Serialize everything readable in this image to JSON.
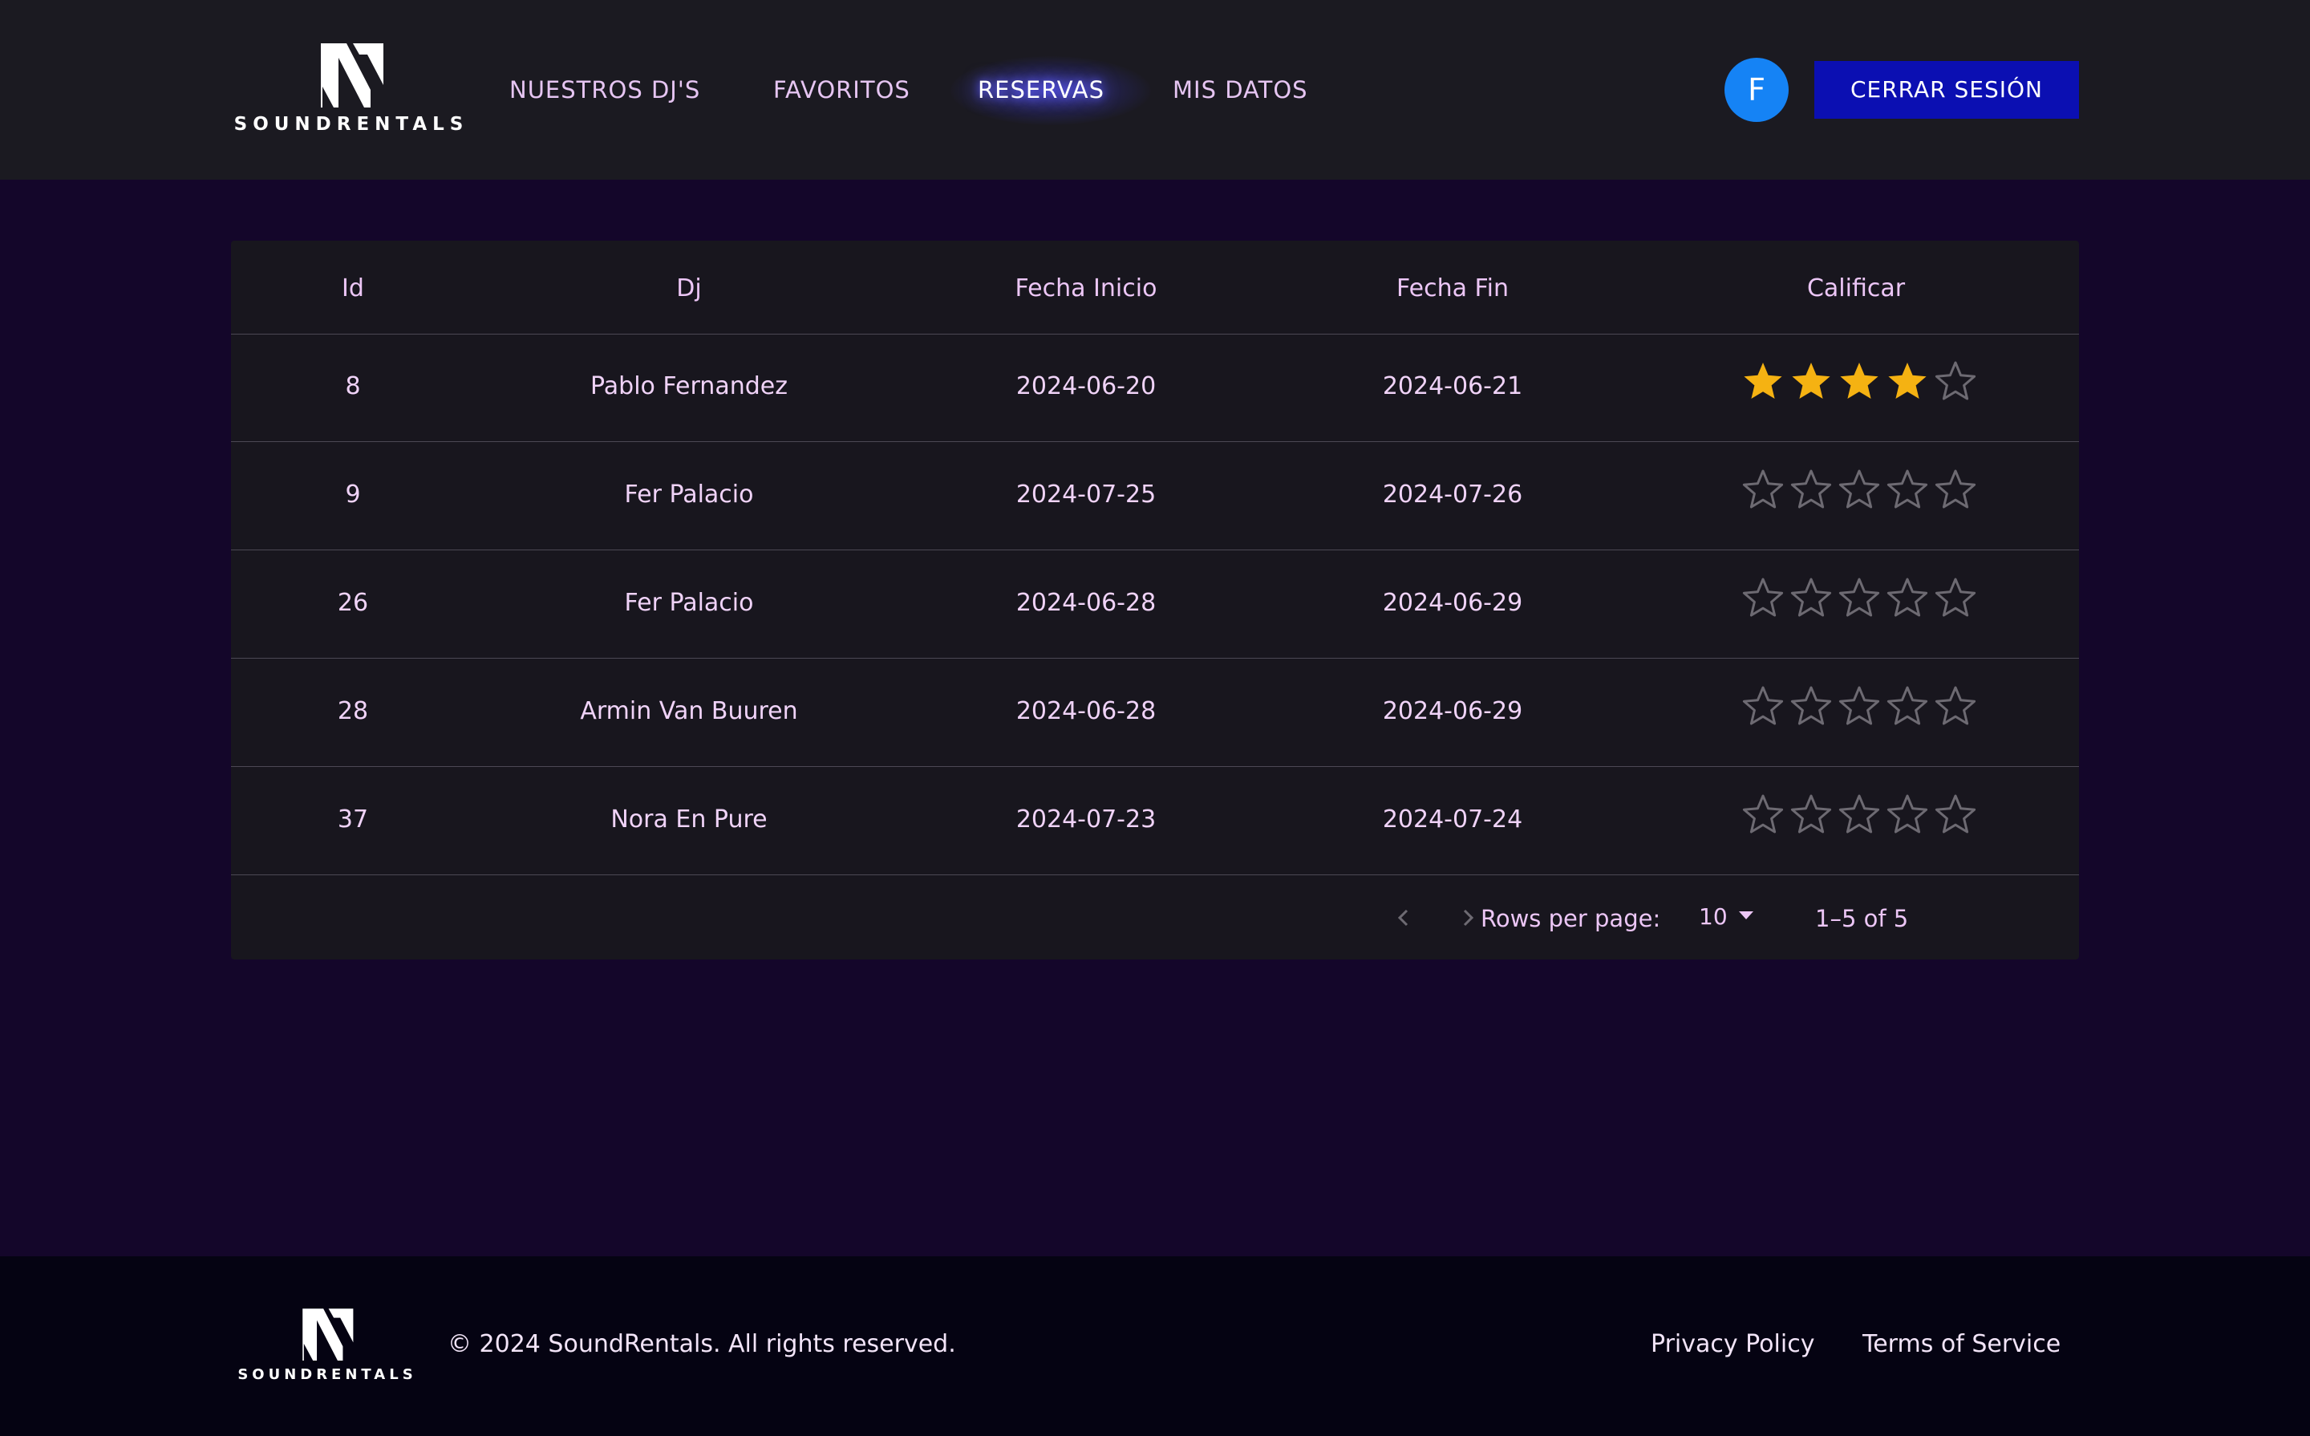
{
  "header": {
    "logo_text": "SOUNDRENTALS",
    "nav": [
      {
        "label": "NUESTROS DJ'S",
        "active": false
      },
      {
        "label": "FAVORITOS",
        "active": false
      },
      {
        "label": "RESERVAS",
        "active": true
      },
      {
        "label": "MIS DATOS",
        "active": false
      }
    ],
    "avatar_initial": "F",
    "logout_label": "CERRAR SESIÓN"
  },
  "table": {
    "columns": [
      "Id",
      "Dj",
      "Fecha Inicio",
      "Fecha Fin",
      "Calificar"
    ],
    "rows": [
      {
        "id": "8",
        "dj": "Pablo Fernandez",
        "start": "2024-06-20",
        "end": "2024-06-21",
        "rating": 4
      },
      {
        "id": "9",
        "dj": "Fer Palacio",
        "start": "2024-07-25",
        "end": "2024-07-26",
        "rating": 0
      },
      {
        "id": "26",
        "dj": "Fer Palacio",
        "start": "2024-06-28",
        "end": "2024-06-29",
        "rating": 0
      },
      {
        "id": "28",
        "dj": "Armin Van Buuren",
        "start": "2024-06-28",
        "end": "2024-06-29",
        "rating": 0
      },
      {
        "id": "37",
        "dj": "Nora En Pure",
        "start": "2024-07-23",
        "end": "2024-07-24",
        "rating": 0
      }
    ],
    "max_rating": 5,
    "pagination": {
      "rows_per_page_label": "Rows per page:",
      "rows_per_page": "10",
      "range": "1–5 of 5"
    }
  },
  "footer": {
    "logo_text": "SOUNDRENTALS",
    "copyright": "© 2024 SoundRentals. All rights reserved.",
    "links": [
      "Privacy Policy",
      "Terms of Service"
    ]
  },
  "colors": {
    "header_bg": "#1b1a21",
    "page_bg": "#14062a",
    "table_bg": "#18161e",
    "accent_button": "#0b0fb2",
    "avatar": "#1583f5",
    "star_filled": "#f5b212",
    "star_empty": "#6d6a72",
    "text": "#e9c9f3"
  },
  "icons": {
    "logo": "soundrentals-logo-icon",
    "star": "star-icon",
    "dropdown": "caret-down-icon",
    "prev": "chevron-left-icon",
    "next": "chevron-right-icon"
  }
}
